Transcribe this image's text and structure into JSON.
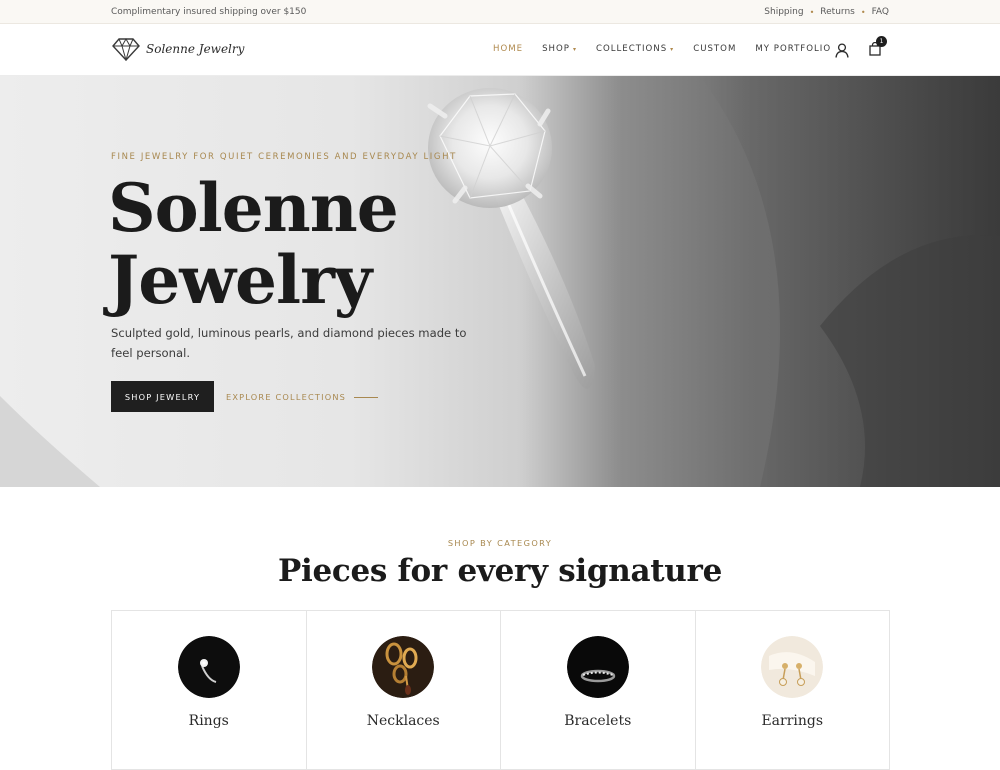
{
  "topbar": {
    "shipping_note": "Complimentary insured shipping over $150",
    "links": [
      "Shipping",
      "Returns",
      "FAQ"
    ],
    "separator": "•"
  },
  "brand": {
    "name": "Solenne Jewelry",
    "logo_icon": "diamond-icon",
    "accent": "#b08a4e"
  },
  "nav": {
    "items": [
      "HOME",
      "SHOP",
      "COLLECTIONS",
      "CUSTOM",
      "MY PORTFOLIO"
    ],
    "caret": "▾",
    "active": "HOME"
  },
  "header_icons": {
    "account_icon": "user-icon",
    "cart_icon": "shopping-bag-icon",
    "cart_count": "1"
  },
  "hero": {
    "eyebrow": "FINE JEWELRY FOR QUIET CEREMONIES AND EVERYDAY LIGHT",
    "title_line1": "Solenne",
    "title_line2": "Jewelry",
    "subtitle": "Sculpted gold, luminous pearls, and diamond pieces made to feel personal.",
    "primary_cta": "SHOP JEWELRY",
    "secondary_cta": "EXPLORE COLLECTIONS"
  },
  "categories": {
    "eyebrow": "SHOP BY CATEGORY",
    "title": "Pieces for every signature",
    "items": [
      {
        "label": "Rings"
      },
      {
        "label": "Necklaces"
      },
      {
        "label": "Bracelets"
      },
      {
        "label": "Earrings"
      }
    ]
  }
}
